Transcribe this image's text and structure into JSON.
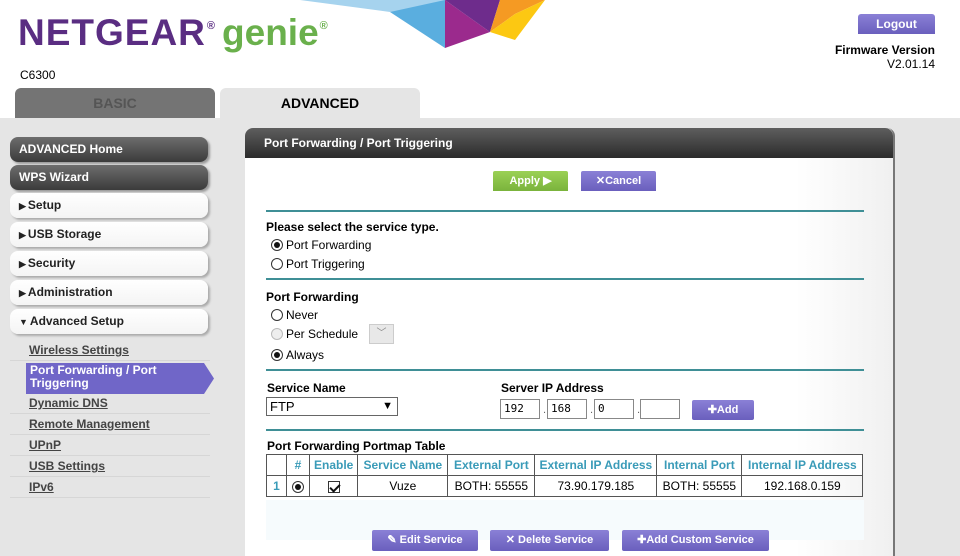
{
  "header": {
    "brand": "NETGEAR",
    "brand_reg": "®",
    "product": "genie",
    "product_reg": "®",
    "model": "C6300",
    "logout_label": "Logout",
    "firmware_label": "Firmware Version",
    "firmware_value": "V2.01.14",
    "tabs": [
      {
        "label": "BASIC",
        "active": false
      },
      {
        "label": "ADVANCED",
        "active": true
      }
    ]
  },
  "sidebar": {
    "items": [
      {
        "label": "ADVANCED Home",
        "style": "dark"
      },
      {
        "label": "WPS Wizard",
        "style": "dark"
      },
      {
        "label": "Setup",
        "arrow": "▶"
      },
      {
        "label": "USB Storage",
        "arrow": "▶"
      },
      {
        "label": "Security",
        "arrow": "▶"
      },
      {
        "label": "Administration",
        "arrow": "▶"
      },
      {
        "label": "Advanced Setup",
        "arrow": "▼"
      }
    ],
    "sub_items": [
      {
        "label": "Wireless Settings"
      },
      {
        "label": "Port Forwarding / Port Triggering",
        "active": true
      },
      {
        "label": "Dynamic DNS"
      },
      {
        "label": "Remote Management"
      },
      {
        "label": "UPnP"
      },
      {
        "label": "USB Settings"
      },
      {
        "label": "IPv6"
      }
    ]
  },
  "panel": {
    "title": "Port Forwarding / Port Triggering",
    "apply_label": "Apply ▶",
    "cancel_label": "Cancel",
    "service_type_label": "Please select the service type.",
    "service_type_options": [
      {
        "label": "Port Forwarding",
        "checked": true
      },
      {
        "label": "Port Triggering",
        "checked": false
      }
    ],
    "port_forwarding_label": "Port Forwarding",
    "schedule_options": [
      {
        "label": "Never",
        "checked": false
      },
      {
        "label": "Per Schedule",
        "checked": false,
        "disabled": true
      },
      {
        "label": "Always",
        "checked": true
      }
    ],
    "service_name_label": "Service Name",
    "service_name_value": "FTP",
    "server_ip_label": "Server IP Address",
    "server_ip": [
      "192",
      "168",
      "0",
      ""
    ],
    "add_label": "Add",
    "table_title": "Port Forwarding Portmap Table",
    "table_headers": [
      "",
      "#",
      "Enable",
      "Service Name",
      "External Port",
      "External IP Address",
      "Internal Port",
      "Internal IP Address"
    ],
    "table_rows": [
      {
        "index": "1",
        "selected": true,
        "enabled": true,
        "service_name": "Vuze",
        "external_port": "BOTH: 55555",
        "external_ip": "73.90.179.185",
        "internal_port": "BOTH: 55555",
        "internal_ip": "192.168.0.159"
      }
    ],
    "edit_label": "Edit Service",
    "delete_label": "Delete Service",
    "add_custom_label": "Add Custom Service"
  },
  "colors": {
    "brand_purple": "#5a2d82",
    "genie_green": "#6ab04c",
    "button_purple": "#6a5fbd",
    "apply_green": "#7ab33c",
    "divider_teal": "#3f8f96",
    "table_header_blue": "#3a9bb8"
  }
}
